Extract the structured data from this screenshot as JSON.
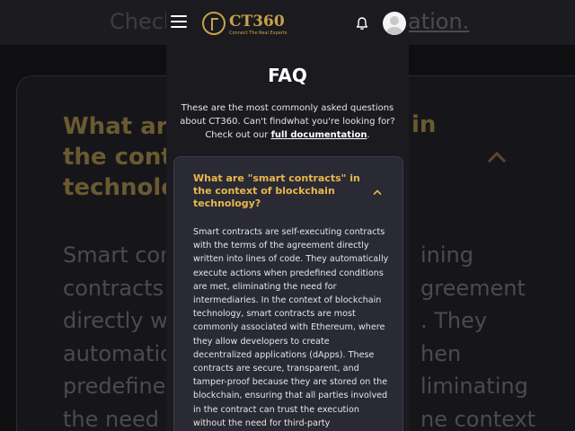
{
  "background": {
    "top_text": "Check",
    "top_link": "ation.",
    "question_left": [
      "What ar",
      "the cont",
      "technolo"
    ],
    "question_right": "in",
    "answer_left": [
      "Smart con",
      "contracts",
      "directly w",
      "automatio",
      "predefine",
      "the need t"
    ],
    "answer_right": [
      "ining",
      "greement",
      ". They",
      "hen",
      "liminating",
      "ne context"
    ]
  },
  "header": {
    "menu_icon": "hamburger-menu-icon",
    "logo_text": "CT360",
    "logo_subtext": "Connect The Real Experts",
    "bell_icon": "bell-icon",
    "avatar_icon": "user-avatar-icon"
  },
  "page": {
    "title": "FAQ",
    "intro_text": "These are the most commonly asked questions about CT360. Can't findwhat you're looking for? Check out our ",
    "intro_link": "full documentation",
    "intro_end": "."
  },
  "faq": {
    "question": "What are \"smart contracts\" in the context of blockchain technology?",
    "chevron_icon": "chevron-up-icon",
    "answer": "Smart contracts are self-executing contracts with the terms of the agreement directly written into lines of code. They automatically execute actions when predefined conditions are met, eliminating the need for intermediaries. In the context of blockchain technology, smart contracts are most commonly associated with Ethereum, where they allow developers to create decentralized applications (dApps). These contracts are secure, transparent, and tamper-proof because they are stored on the blockchain, ensuring that all parties involved in the contract can trust the execution without the need for third-party"
  },
  "colors": {
    "accent": "#e8b84a",
    "page_bg": "#1a1a1f",
    "card_bg": "#2a2a35"
  }
}
